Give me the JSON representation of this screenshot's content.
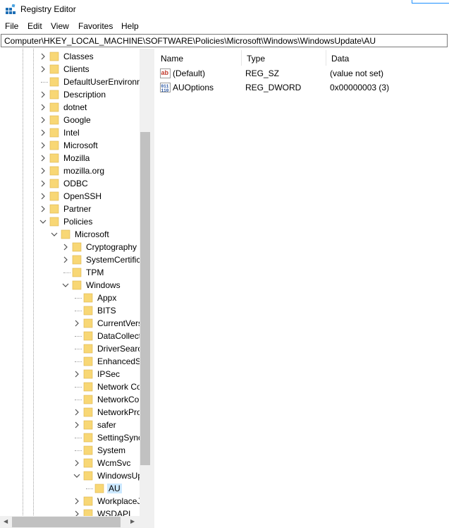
{
  "window": {
    "title": "Registry Editor"
  },
  "menu": [
    "File",
    "Edit",
    "View",
    "Favorites",
    "Help"
  ],
  "address": "Computer\\HKEY_LOCAL_MACHINE\\SOFTWARE\\Policies\\Microsoft\\Windows\\WindowsUpdate\\AU",
  "tree": [
    {
      "label": "Classes",
      "level": 0,
      "chevron": "right"
    },
    {
      "label": "Clients",
      "level": 0,
      "chevron": "right"
    },
    {
      "label": "DefaultUserEnvironn",
      "level": 0,
      "chevron": "none"
    },
    {
      "label": "Description",
      "level": 0,
      "chevron": "right"
    },
    {
      "label": "dotnet",
      "level": 0,
      "chevron": "right"
    },
    {
      "label": "Google",
      "level": 0,
      "chevron": "right"
    },
    {
      "label": "Intel",
      "level": 0,
      "chevron": "right"
    },
    {
      "label": "Microsoft",
      "level": 0,
      "chevron": "right"
    },
    {
      "label": "Mozilla",
      "level": 0,
      "chevron": "right"
    },
    {
      "label": "mozilla.org",
      "level": 0,
      "chevron": "right"
    },
    {
      "label": "ODBC",
      "level": 0,
      "chevron": "right"
    },
    {
      "label": "OpenSSH",
      "level": 0,
      "chevron": "right"
    },
    {
      "label": "Partner",
      "level": 0,
      "chevron": "right"
    },
    {
      "label": "Policies",
      "level": 0,
      "chevron": "down"
    },
    {
      "label": "Microsoft",
      "level": 1,
      "chevron": "down"
    },
    {
      "label": "Cryptography",
      "level": 2,
      "chevron": "right"
    },
    {
      "label": "SystemCertific",
      "level": 2,
      "chevron": "right"
    },
    {
      "label": "TPM",
      "level": 2,
      "chevron": "none"
    },
    {
      "label": "Windows",
      "level": 2,
      "chevron": "down"
    },
    {
      "label": "Appx",
      "level": 3,
      "chevron": "none"
    },
    {
      "label": "BITS",
      "level": 3,
      "chevron": "none"
    },
    {
      "label": "CurrentVers",
      "level": 3,
      "chevron": "right"
    },
    {
      "label": "DataCollect",
      "level": 3,
      "chevron": "none"
    },
    {
      "label": "DriverSearc",
      "level": 3,
      "chevron": "none"
    },
    {
      "label": "EnhancedS",
      "level": 3,
      "chevron": "none"
    },
    {
      "label": "IPSec",
      "level": 3,
      "chevron": "right"
    },
    {
      "label": "Network Co",
      "level": 3,
      "chevron": "none"
    },
    {
      "label": "NetworkCo",
      "level": 3,
      "chevron": "none"
    },
    {
      "label": "NetworkPro",
      "level": 3,
      "chevron": "right"
    },
    {
      "label": "safer",
      "level": 3,
      "chevron": "right"
    },
    {
      "label": "SettingSync",
      "level": 3,
      "chevron": "none"
    },
    {
      "label": "System",
      "level": 3,
      "chevron": "none"
    },
    {
      "label": "WcmSvc",
      "level": 3,
      "chevron": "right"
    },
    {
      "label": "WindowsUp",
      "level": 3,
      "chevron": "down"
    },
    {
      "label": "AU",
      "level": 4,
      "chevron": "none",
      "selected": true
    },
    {
      "label": "WorkplaceJ",
      "level": 3,
      "chevron": "right"
    },
    {
      "label": "WSDAPI",
      "level": 3,
      "chevron": "right"
    }
  ],
  "columns": [
    "Name",
    "Type",
    "Data"
  ],
  "values": [
    {
      "icon": "string-value-icon",
      "name": "(Default)",
      "type": "REG_SZ",
      "data": "(value not set)"
    },
    {
      "icon": "dword-value-icon",
      "name": "AUOptions",
      "type": "REG_DWORD",
      "data": "0x00000003 (3)"
    }
  ],
  "colors": {
    "folder": "#f8d775",
    "folder_edge": "#dcb44a",
    "selection": "#cce8ff",
    "accent": "#1e90ff"
  }
}
